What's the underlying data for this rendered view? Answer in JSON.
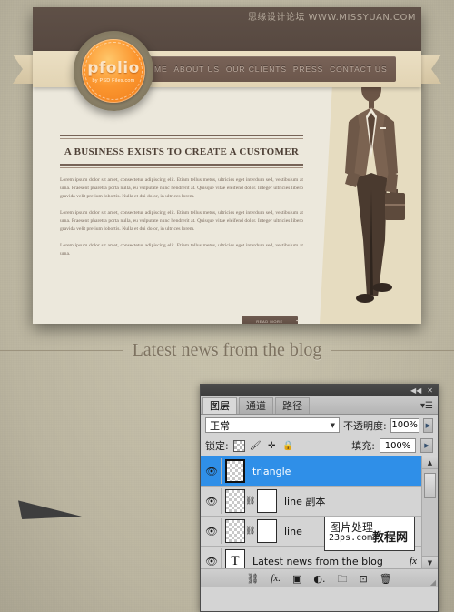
{
  "watermarks": {
    "top_right": "思缘设计论坛 WWW.MISSYUAN.COM",
    "box_line1": "图片处理",
    "box_line2": "23ps.com",
    "box_line3": "教程网"
  },
  "site": {
    "logo": {
      "name": "pfolio",
      "tagline": "by PSD Files.com"
    },
    "nav": [
      {
        "label": "HOME"
      },
      {
        "label": "ABOUT US"
      },
      {
        "label": "OUR CLIENTS"
      },
      {
        "label": "PRESS"
      },
      {
        "label": "CONTACT US"
      }
    ],
    "article": {
      "heading": "A BUSINESS EXISTS TO CREATE A CUSTOMER",
      "paragraphs": [
        "Lorem ipsum dolor sit amet, consectetur adipiscing elit. Etiam tellus metus, ultricies eget interdum sed, vestibulum at urna. Praesent pharetra porta nulla, eu vulputate nunc hendrerit at. Quisque vitae eleifend dolor. Integer ultricies libero gravida velit pretium lobortis. Nulla et dui dolor, in ultrices lorem.",
        "Lorem ipsum dolor sit amet, consectetur adipiscing elit. Etiam tellus metus, ultricies eget interdum sed, vestibulum at urna. Praesent pharetra porta nulla, eu vulputate nunc hendrerit at. Quisque vitae eleifend dolor. Integer ultricies libero gravida velit pretium lobortis. Nulla et dui dolor, in ultrices lorem.",
        "Lorem ipsum dolor sit amet, consectetur adipiscing elit. Etiam tellus metus, ultricies eget interdum sed, vestibulum at urna."
      ],
      "read_more_label": "READ MORE"
    }
  },
  "divider": {
    "title": "Latest news from the blog"
  },
  "photoshop": {
    "titlebar": {
      "collapse_label": "◀◀",
      "close_label": "✕"
    },
    "tabs": [
      {
        "label": "图层",
        "active": true
      },
      {
        "label": "通道",
        "active": false
      },
      {
        "label": "路径",
        "active": false
      }
    ],
    "tab_menu_label": "▾☰",
    "blend": {
      "mode": "正常",
      "caret": "▼",
      "opacity_label": "不透明度:",
      "opacity_value": "100%",
      "stepper": "▶"
    },
    "lock": {
      "label": "锁定:",
      "icons": [
        "lock-transparency-icon",
        "lock-pixels-icon",
        "lock-position-icon",
        "lock-all-icon"
      ],
      "fill_label": "填充:",
      "fill_value": "100%",
      "stepper": "▶"
    },
    "layers": [
      {
        "name": "triangle",
        "selected": true,
        "visible": true,
        "kind": "shape",
        "has_mask": false,
        "has_fx": false
      },
      {
        "name": "line 副本",
        "selected": false,
        "visible": true,
        "kind": "shape",
        "has_mask": true,
        "has_fx": false
      },
      {
        "name": "line",
        "selected": false,
        "visible": true,
        "kind": "shape",
        "has_mask": true,
        "has_fx": false
      },
      {
        "name": "Latest news from the blog",
        "selected": false,
        "visible": true,
        "kind": "text",
        "has_mask": false,
        "has_fx": true
      }
    ],
    "scrollbar": {
      "up": "▲",
      "down": "▼"
    },
    "footer_icons": [
      "link-icon",
      "fx-icon",
      "mask-icon",
      "adjustment-icon",
      "group-folder-icon",
      "new-layer-icon",
      "trash-icon"
    ],
    "eye_glyph": "👁",
    "chain_glyph": "⛓",
    "fx_glyph": "fx"
  },
  "colors": {
    "canvas": "#c2bca6",
    "header_brown": "#5f5047",
    "ribbon_cream": "#e7d9bb",
    "nav_brown": "#6c574c",
    "logo_orange": "#f89528",
    "page_cream": "#ece8dc",
    "illustration_tan": "#e6dcc0",
    "selected_blue": "#2f8fe8",
    "triangle_dark": "#3e3e3e"
  }
}
